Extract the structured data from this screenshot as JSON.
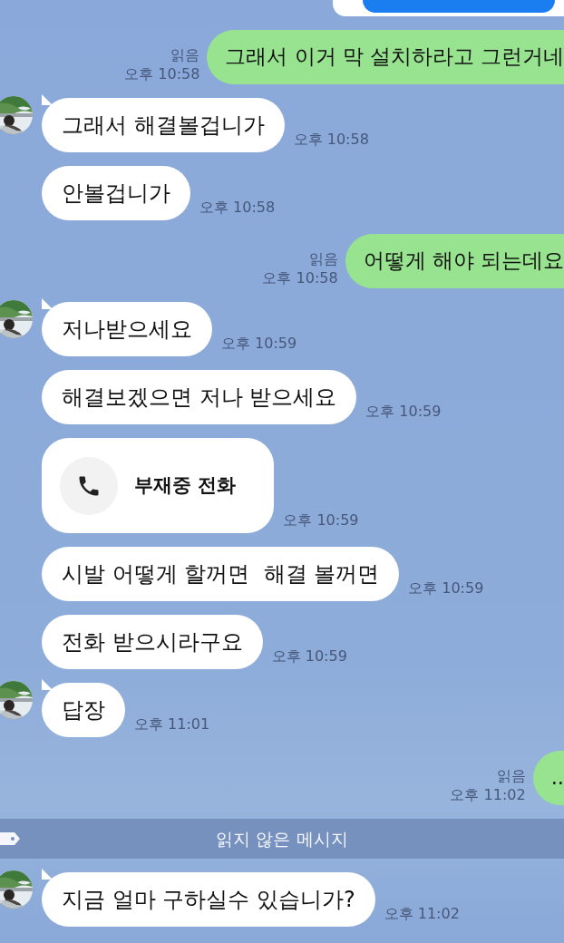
{
  "messages": [
    {
      "kind": "cut_card"
    },
    {
      "kind": "sent",
      "text": "그래서 이거 막 설치하라고 그런거네",
      "read": "읽음",
      "time": "오후 10:58"
    },
    {
      "kind": "received",
      "avatar": true,
      "text": "그래서 해결볼겁니가",
      "time": "오후 10:58"
    },
    {
      "kind": "received",
      "avatar": false,
      "text": "안볼겁니가",
      "time": "오후 10:58"
    },
    {
      "kind": "sent",
      "text": "어떻게 해야 되는데요",
      "read": "읽음",
      "time": "오후 10:58"
    },
    {
      "kind": "received",
      "avatar": true,
      "text": "저나받으세요",
      "time": "오후 10:59"
    },
    {
      "kind": "received",
      "avatar": false,
      "text": "해결보겠으면 저나 받으세요",
      "time": "오후 10:59"
    },
    {
      "kind": "missed_call",
      "avatar": false,
      "text": "부재중 전화",
      "time": "오후 10:59"
    },
    {
      "kind": "received",
      "avatar": false,
      "text": "시발 어떻게 할꺼면  해결 볼꺼면",
      "time": "오후 10:59"
    },
    {
      "kind": "received",
      "avatar": false,
      "text": "전화 받으시라구요",
      "time": "오후 10:59"
    },
    {
      "kind": "received",
      "avatar": true,
      "text": "답장",
      "time": "오후 11:01"
    },
    {
      "kind": "sent",
      "text": "..",
      "read": "읽음",
      "time": "오후 11:02"
    },
    {
      "kind": "divider",
      "text": "읽지 않은 메시지"
    },
    {
      "kind": "received",
      "avatar": true,
      "text": "지금 얼마 구하실수 있습니가?",
      "time": "오후 11:02"
    }
  ]
}
